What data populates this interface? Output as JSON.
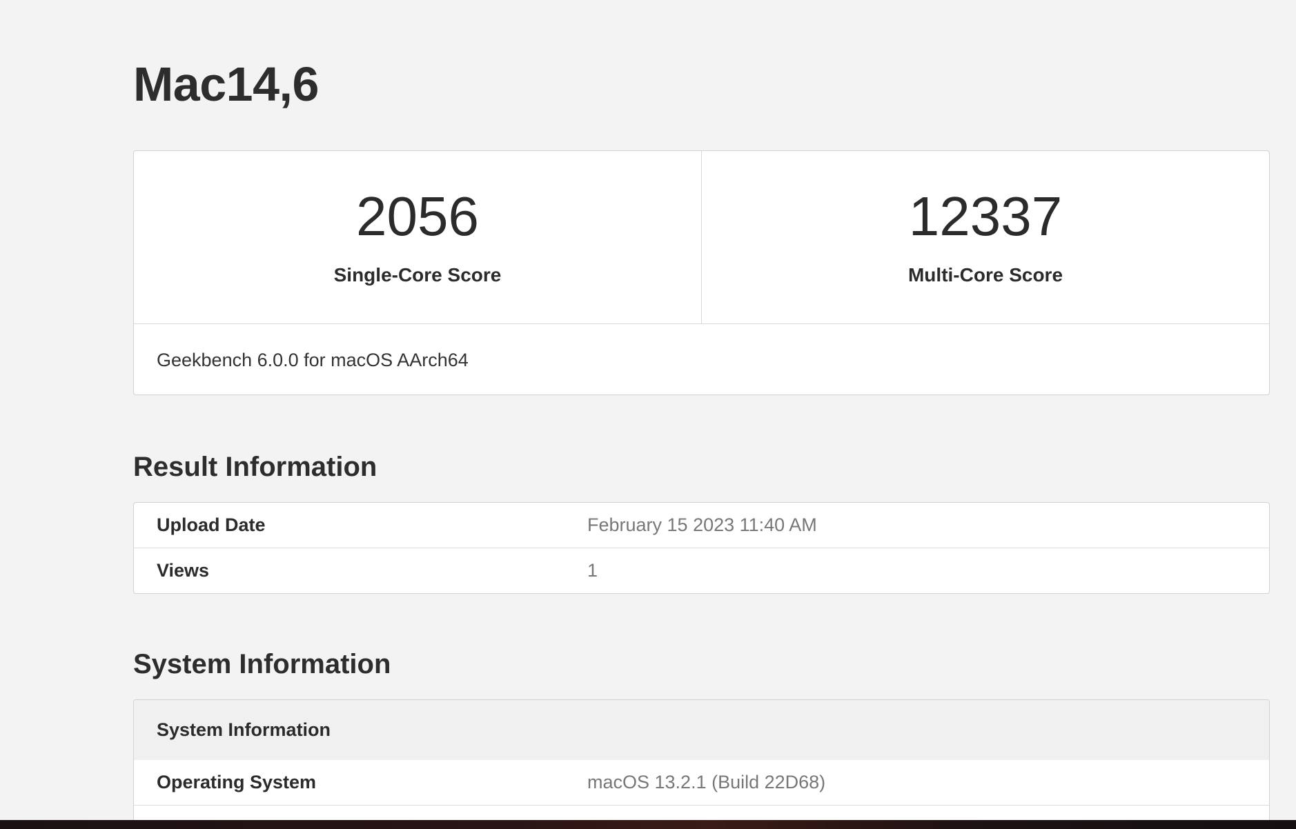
{
  "page": {
    "title": "Mac14,6"
  },
  "scores": {
    "single_core": {
      "value": "2056",
      "label": "Single-Core Score"
    },
    "multi_core": {
      "value": "12337",
      "label": "Multi-Core Score"
    },
    "version": "Geekbench 6.0.0 for macOS AArch64"
  },
  "result_information": {
    "heading": "Result Information",
    "rows": [
      {
        "key": "Upload Date",
        "value": "February 15 2023 11:40 AM"
      },
      {
        "key": "Views",
        "value": "1"
      }
    ]
  },
  "system_information": {
    "heading": "System Information",
    "table_header": "System Information",
    "rows": [
      {
        "key": "Operating System",
        "value": "macOS 13.2.1 (Build 22D68)"
      }
    ]
  },
  "colors": {
    "page_background": "#f3f3f3",
    "card_background": "#ffffff",
    "border": "#d2d2d2",
    "text_primary": "#2b2b2b",
    "text_secondary": "#777777",
    "table_header_background": "#f0f0f0"
  }
}
